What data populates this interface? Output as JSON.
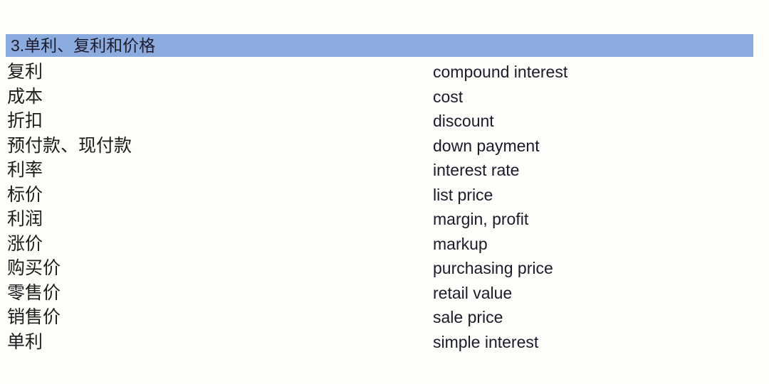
{
  "slide": {
    "background_color": "#fdfdfa",
    "section_header": {
      "title": "3.单利、复利和价格",
      "background_color": "#8cace0",
      "text_color": "#1c1c2a"
    },
    "columns": {
      "chinese_header": "",
      "english_header": ""
    },
    "vocabulary": [
      {
        "zh": "复利",
        "en": "compound interest"
      },
      {
        "zh": "成本",
        "en": "cost"
      },
      {
        "zh": "折扣",
        "en": "discount"
      },
      {
        "zh": "预付款、现付款",
        "en": "down payment"
      },
      {
        "zh": "利率",
        "en": "interest rate"
      },
      {
        "zh": "标价",
        "en": "list price"
      },
      {
        "zh": "利润",
        "en": "margin, profit"
      },
      {
        "zh": "涨价",
        "en": "markup"
      },
      {
        "zh": "购买价",
        "en": "purchasing price"
      },
      {
        "zh": "零售价",
        "en": "retail value"
      },
      {
        "zh": "销售价",
        "en": "sale price"
      },
      {
        "zh": "单利",
        "en": "simple interest"
      }
    ]
  }
}
